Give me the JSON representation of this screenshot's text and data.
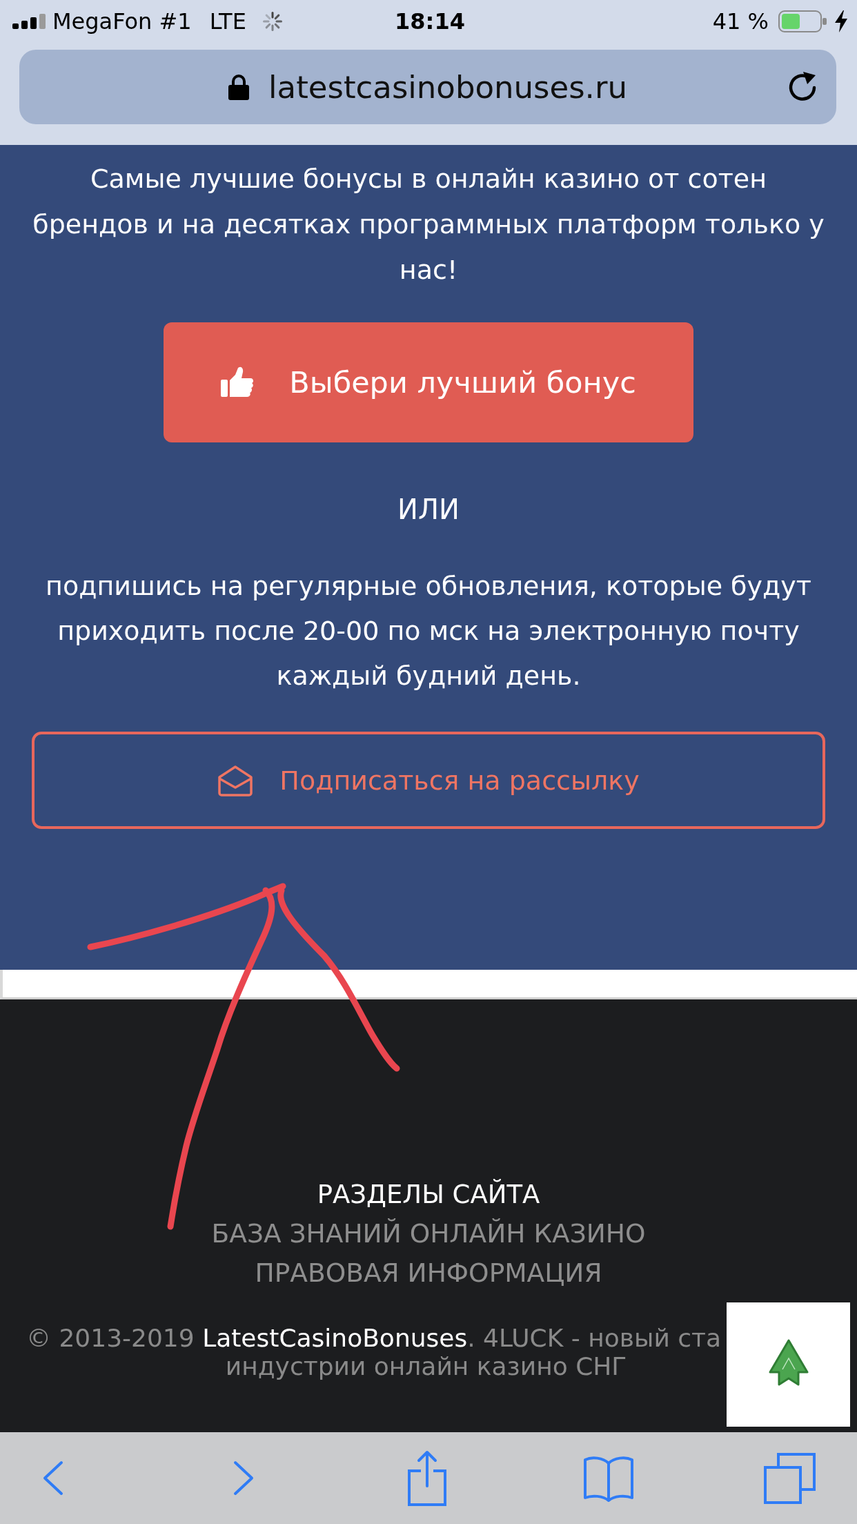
{
  "status_bar": {
    "carrier": "MegaFon #1",
    "network": "LTE",
    "time": "18:14",
    "battery_percent": "41 %"
  },
  "address_bar": {
    "url": "latestcasinobonuses.ru"
  },
  "hero": {
    "intro": "Самые лучшие бонусы в онлайн казино от сотен брендов и на десятках программных платформ только у нас!",
    "bonus_button": {
      "label": "Выбери лучший бонус"
    },
    "separator": "ИЛИ",
    "subscribe_text": "подпишись на регулярные обновления, которые будут приходить после 20-00 по мск на электронную почту каждый будний день.",
    "subscribe_button": {
      "label": "Подписаться на рассылку"
    }
  },
  "footer": {
    "heading": "РАЗДЕЛЫ САЙТА",
    "links": [
      "БАЗА ЗНАНИЙ ОНЛАЙН КАЗИНО",
      "ПРАВОВАЯ ИНФОРМАЦИЯ"
    ],
    "copyright": {
      "years": "© 2013-2019",
      "link": "LatestCasinoBonuses",
      "line_1_end": ". 4LUCK - новый ста",
      "line_2": "индустрии онлайн казино СНГ"
    }
  }
}
